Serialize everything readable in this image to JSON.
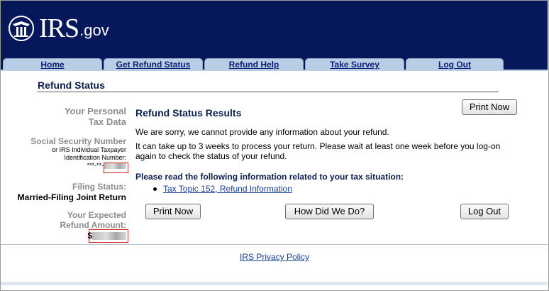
{
  "logo": {
    "irs": "IRS",
    "gov": ".gov"
  },
  "nav": {
    "tabs": [
      {
        "label": "Home"
      },
      {
        "label": "Get Refund Status"
      },
      {
        "label": "Refund Help"
      },
      {
        "label": "Take Survey"
      },
      {
        "label": "Log Out"
      }
    ]
  },
  "page_title": "Refund Status",
  "sidebar": {
    "heading_line1": "Your Personal",
    "heading_line2": "Tax Data",
    "ssn_label": "Social Security Number",
    "itin_line1": "or IRS Individual Taxpayer",
    "itin_line2": "Identification Number:",
    "ssn_prefix": "***-**-",
    "filing_status_label": "Filing Status:",
    "filing_status_value": "Married-Filing Joint Return",
    "refund_label_line1": "Your Expected",
    "refund_label_line2": "Refund Amount:",
    "refund_prefix": "$"
  },
  "results": {
    "title": "Refund Status Results",
    "message1": "We are sorry, we cannot provide any information about your refund.",
    "message2_line1": "It can take up to 3 weeks to process your return. Please wait at least one week before you log-on",
    "message2_line2": "again to check the status of your refund.",
    "info_heading": "Please read the following information related to your tax situation:",
    "topic_link": "Tax Topic 152, Refund Information"
  },
  "buttons": {
    "print_top": "Print Now",
    "print_bottom": "Print Now",
    "how_did_we_do": "How Did We Do?",
    "log_out": "Log Out"
  },
  "footer": {
    "privacy_link": "IRS Privacy Policy"
  },
  "colors": {
    "header_bg": "#06185b",
    "tab_bg": "#b9cde5",
    "title_color": "#0b1f4d",
    "redact_border": "#d11d1d"
  }
}
